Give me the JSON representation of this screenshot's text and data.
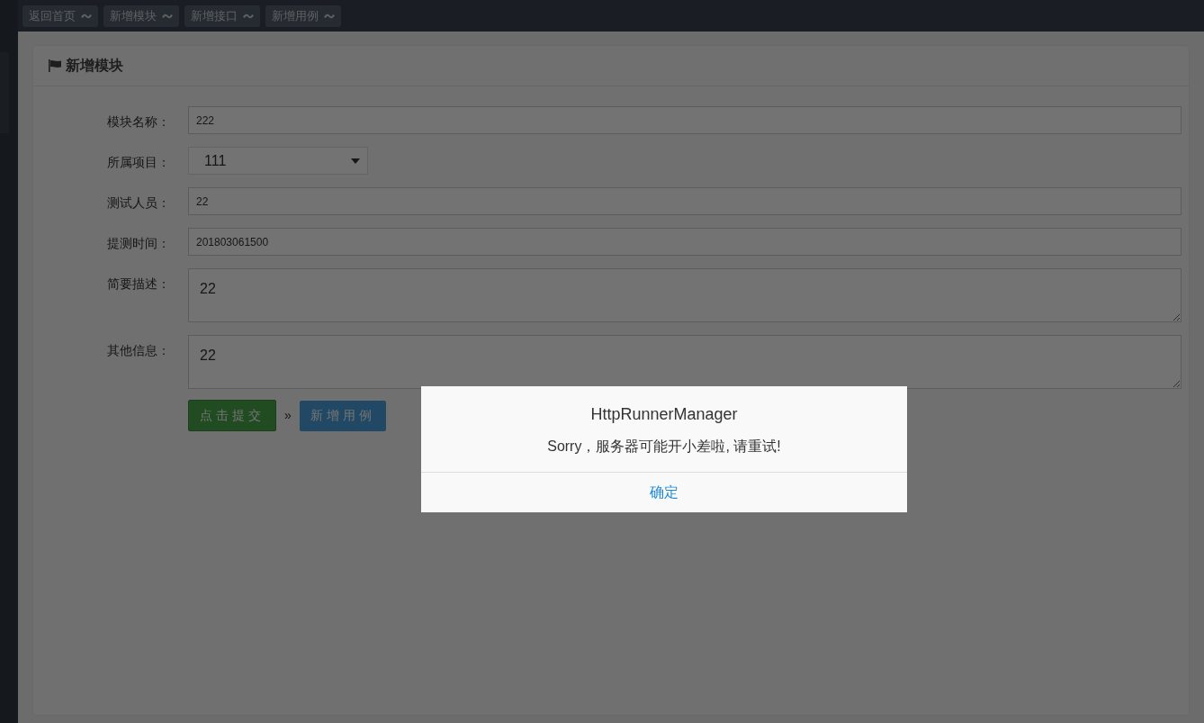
{
  "top_tabs": [
    {
      "label": "返回首页"
    },
    {
      "label": "新增模块"
    },
    {
      "label": "新增接口"
    },
    {
      "label": "新增用例"
    }
  ],
  "panel": {
    "title": "新增模块"
  },
  "form": {
    "fields": [
      {
        "kind": "input",
        "label": "模块名称：",
        "value": "222"
      },
      {
        "kind": "select",
        "label": "所属项目：",
        "value": "111"
      },
      {
        "kind": "input",
        "label": "测试人员：",
        "value": "22"
      },
      {
        "kind": "input",
        "label": "提测时间：",
        "value": "201803061500"
      },
      {
        "kind": "textarea",
        "label": "简要描述：",
        "value": "22"
      },
      {
        "kind": "textarea",
        "label": "其他信息：",
        "value": "22"
      }
    ]
  },
  "actions": {
    "submit": "点击提交",
    "separator": "»",
    "add_case": "新增用例"
  },
  "dialog": {
    "title": "HttpRunnerManager",
    "message": "Sorry，服务器可能开小差啦, 请重试!",
    "confirm": "确定"
  }
}
